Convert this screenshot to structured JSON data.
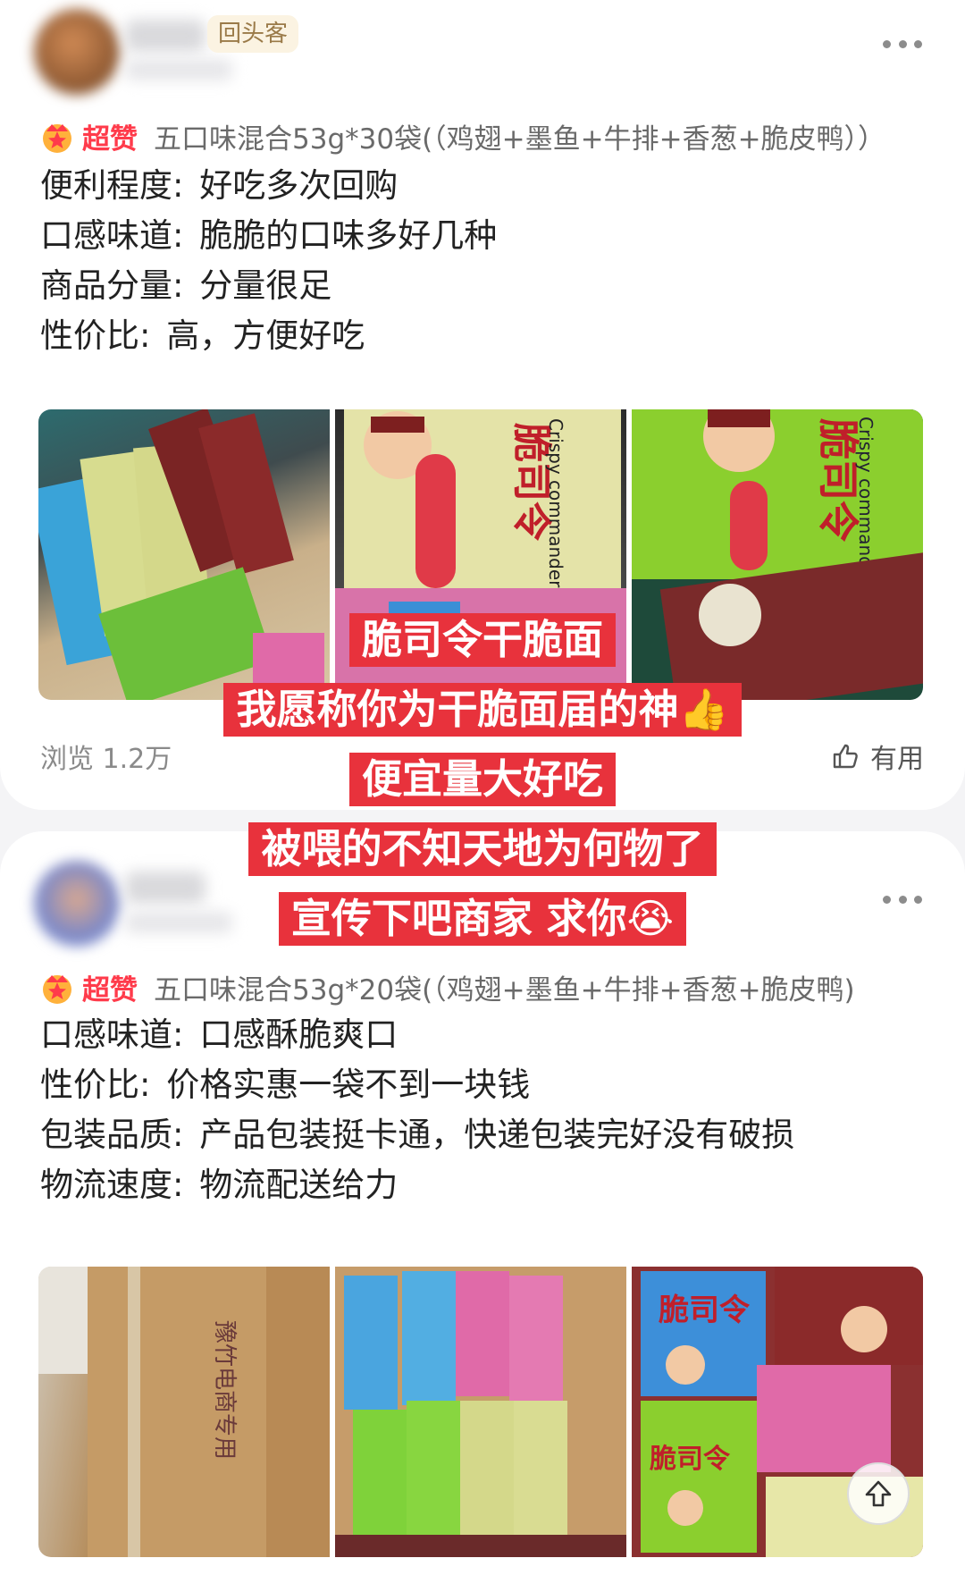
{
  "reviews": [
    {
      "badge": "回头客",
      "tag": "超赞",
      "product": "五口味混合53g*30袋(（鸡翅+墨鱼+牛排+香葱+脆皮鸭））",
      "lines": [
        {
          "key": "便利程度",
          "sep": ":",
          "value": "好吃多次回购"
        },
        {
          "key": "口感味道",
          "sep": ":",
          "value": "脆脆的口味多好几种"
        },
        {
          "key": "商品分量",
          "sep": ":",
          "value": "分量很足"
        },
        {
          "key": "性价比",
          "sep": ":",
          "value": "高，方便好吃"
        }
      ],
      "views": "浏览 1.2万",
      "useful": "有用"
    },
    {
      "tag": "超赞",
      "product": "五口味混合53g*20袋(（鸡翅+墨鱼+牛排+香葱+脆皮鸭)",
      "lines": [
        {
          "key": "口感味道",
          "sep": ":",
          "value": "口感酥脆爽口"
        },
        {
          "key": "性价比",
          "sep": ":",
          "value": "价格实惠一袋不到一块钱"
        },
        {
          "key": "包装品质",
          "sep": ":",
          "value": "产品包装挺卡通，快递包装完好没有破损"
        },
        {
          "key": "物流速度",
          "sep": ":",
          "value": "物流配送给力"
        }
      ]
    }
  ],
  "overlay_captions": [
    "脆司令干脆面",
    "我愿称你为干脆面届的神👍",
    "便宜量大好吃",
    "被喂的不知天地为何物了",
    "宣传下吧商家 求你😭"
  ],
  "photo_text": {
    "brand_cn": "脆司令",
    "brand_en": "Crispy commander",
    "carton_label": "豫竹电商专用"
  },
  "colors": {
    "accent_red": "#ff3b4b",
    "caption_bg": "#e8323c",
    "badge_bg": "#fbf3e2"
  },
  "icons": [
    "crown-badge-icon",
    "more-icon",
    "thumbs-up-icon",
    "scroll-top-icon"
  ]
}
